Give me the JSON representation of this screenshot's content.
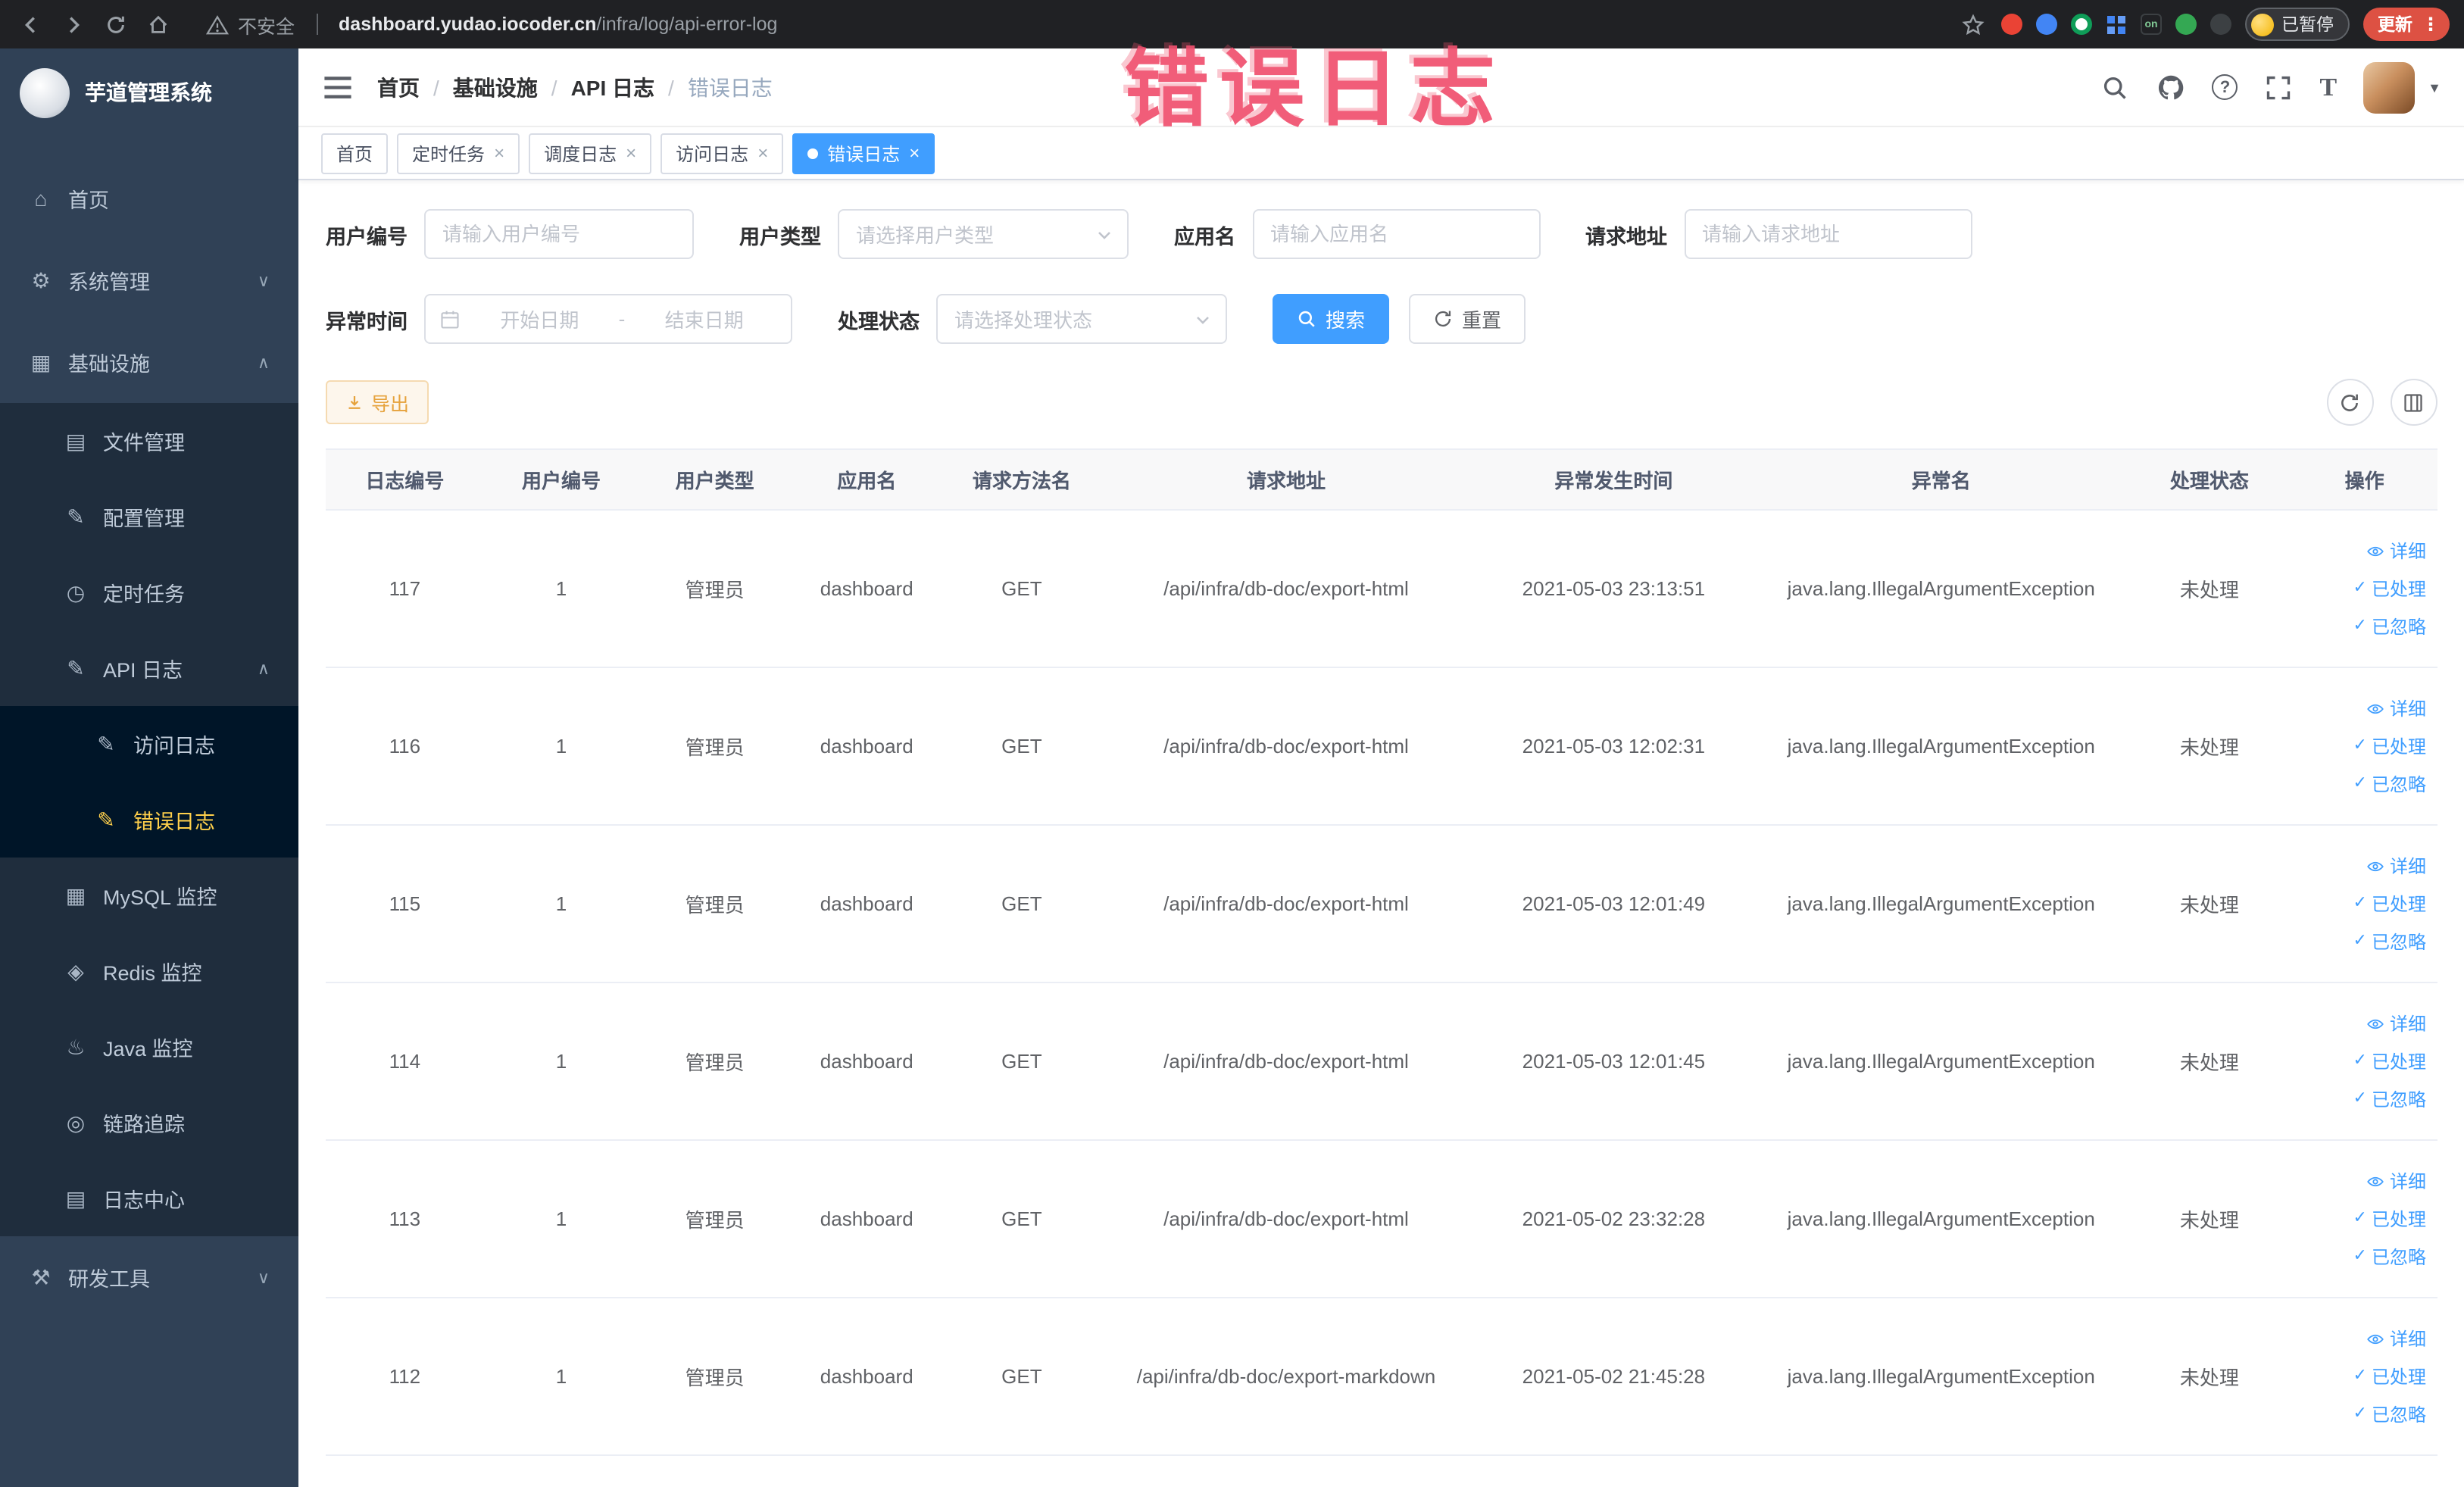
{
  "browser": {
    "security_label": "不安全",
    "url_domain": "dashboard.yudao.iocoder.cn",
    "url_path": "/infra/log/api-error-log",
    "paused_label": "已暂停",
    "update_label": "更新",
    "kebab": "⋮"
  },
  "annotation": {
    "text": "错误日志"
  },
  "sidebar": {
    "logo_title": "芋道管理系统",
    "items": [
      {
        "label": "首页",
        "icon": "⌂"
      },
      {
        "label": "系统管理",
        "icon": "⚙",
        "chevron": "∨"
      },
      {
        "label": "基础设施",
        "icon": "▦",
        "chevron": "∧"
      },
      {
        "label": "文件管理",
        "icon": "▤"
      },
      {
        "label": "配置管理",
        "icon": "✎"
      },
      {
        "label": "定时任务",
        "icon": "◷"
      },
      {
        "label": "API 日志",
        "icon": "✎",
        "chevron": "∧"
      },
      {
        "label": "访问日志",
        "icon": "✎"
      },
      {
        "label": "错误日志",
        "icon": "✎"
      },
      {
        "label": "MySQL 监控",
        "icon": "▦"
      },
      {
        "label": "Redis 监控",
        "icon": "◈"
      },
      {
        "label": "Java 监控",
        "icon": "♨"
      },
      {
        "label": "链路追踪",
        "icon": "◎"
      },
      {
        "label": "日志中心",
        "icon": "▤"
      },
      {
        "label": "研发工具",
        "icon": "⚒",
        "chevron": "∨"
      }
    ]
  },
  "navbar": {
    "breadcrumb": [
      {
        "label": "首页"
      },
      {
        "label": "基础设施"
      },
      {
        "label": "API 日志"
      },
      {
        "label": "错误日志"
      }
    ]
  },
  "tabs": [
    {
      "label": "首页"
    },
    {
      "label": "定时任务"
    },
    {
      "label": "调度日志"
    },
    {
      "label": "访问日志"
    },
    {
      "label": "错误日志"
    }
  ],
  "filters": {
    "user_id_label": "用户编号",
    "user_id_placeholder": "请输入用户编号",
    "user_type_label": "用户类型",
    "user_type_placeholder": "请选择用户类型",
    "app_name_label": "应用名",
    "app_name_placeholder": "请输入应用名",
    "request_url_label": "请求地址",
    "request_url_placeholder": "请输入请求地址",
    "exception_time_label": "异常时间",
    "date_start_placeholder": "开始日期",
    "date_separator": "-",
    "date_end_placeholder": "结束日期",
    "process_status_label": "处理状态",
    "process_status_placeholder": "请选择处理状态",
    "search_label": "搜索",
    "reset_label": "重置"
  },
  "toolbar": {
    "export_label": "导出"
  },
  "table": {
    "headers": [
      "日志编号",
      "用户编号",
      "用户类型",
      "应用名",
      "请求方法名",
      "请求地址",
      "异常发生时间",
      "异常名",
      "处理状态",
      "操作"
    ],
    "action_labels": {
      "detail": "详细",
      "processed": "已处理",
      "ignored": "已忽略"
    },
    "rows": [
      {
        "id": "117",
        "user_id": "1",
        "user_type": "管理员",
        "app_name": "dashboard",
        "method": "GET",
        "url": "/api/infra/db-doc/export-html",
        "time": "2021-05-03 23:13:51",
        "exception": "java.lang.IllegalArgumentException",
        "status": "未处理"
      },
      {
        "id": "116",
        "user_id": "1",
        "user_type": "管理员",
        "app_name": "dashboard",
        "method": "GET",
        "url": "/api/infra/db-doc/export-html",
        "time": "2021-05-03 12:02:31",
        "exception": "java.lang.IllegalArgumentException",
        "status": "未处理"
      },
      {
        "id": "115",
        "user_id": "1",
        "user_type": "管理员",
        "app_name": "dashboard",
        "method": "GET",
        "url": "/api/infra/db-doc/export-html",
        "time": "2021-05-03 12:01:49",
        "exception": "java.lang.IllegalArgumentException",
        "status": "未处理"
      },
      {
        "id": "114",
        "user_id": "1",
        "user_type": "管理员",
        "app_name": "dashboard",
        "method": "GET",
        "url": "/api/infra/db-doc/export-html",
        "time": "2021-05-03 12:01:45",
        "exception": "java.lang.IllegalArgumentException",
        "status": "未处理"
      },
      {
        "id": "113",
        "user_id": "1",
        "user_type": "管理员",
        "app_name": "dashboard",
        "method": "GET",
        "url": "/api/infra/db-doc/export-html",
        "time": "2021-05-02 23:32:28",
        "exception": "java.lang.IllegalArgumentException",
        "status": "未处理"
      },
      {
        "id": "112",
        "user_id": "1",
        "user_type": "管理员",
        "app_name": "dashboard",
        "method": "GET",
        "url": "/api/infra/db-doc/export-markdown",
        "time": "2021-05-02 21:45:28",
        "exception": "java.lang.IllegalArgumentException",
        "status": "未处理"
      }
    ]
  }
}
